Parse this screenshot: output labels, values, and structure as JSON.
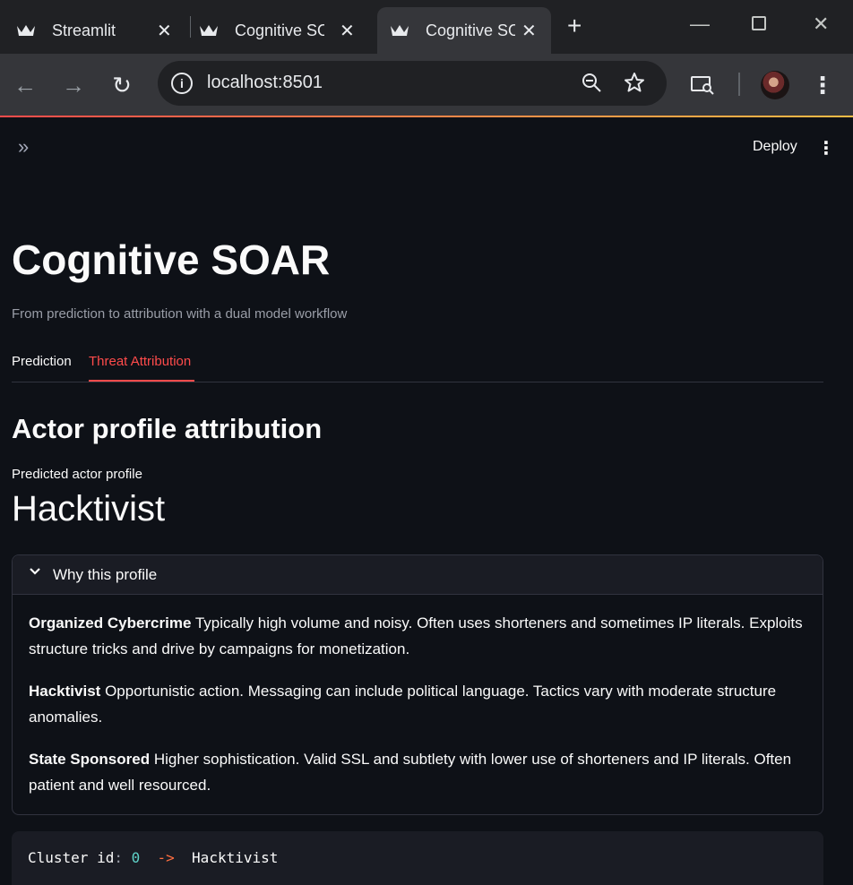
{
  "browser": {
    "tabs": [
      {
        "title": "Streamlit",
        "active": false
      },
      {
        "title": "Cognitive SOAR",
        "active": false
      },
      {
        "title": "Cognitive SOAR",
        "active": true
      }
    ],
    "url": "localhost:8501"
  },
  "app": {
    "deploy_label": "Deploy",
    "title": "Cognitive SOAR",
    "caption": "From prediction to attribution with a dual model workflow",
    "tabs": [
      {
        "label": "Prediction",
        "active": false
      },
      {
        "label": "Threat Attribution",
        "active": true
      }
    ],
    "section_title": "Actor profile attribution",
    "metric": {
      "label": "Predicted actor profile",
      "value": "Hacktivist"
    },
    "expander": {
      "title": "Why this profile",
      "expanded": true,
      "profiles": [
        {
          "name": "Organized Cybercrime",
          "text": "Typically high volume and noisy. Often uses shorteners and sometimes IP literals. Exploits structure tricks and drive by campaigns for monetization."
        },
        {
          "name": "Hacktivist",
          "text": "Opportunistic action. Messaging can include political language. Tactics vary with moderate structure anomalies."
        },
        {
          "name": "State Sponsored",
          "text": "Higher sophistication. Valid SSL and subtlety with lower use of shorteners and IP literals. Often patient and well resourced."
        }
      ]
    },
    "code": {
      "key": "Cluster id",
      "colon": ":",
      "cluster": "0",
      "arrow": "->",
      "profile": "Hacktivist"
    }
  },
  "colors": {
    "accent": "#ff4b4b",
    "background": "#0e1117",
    "code_number": "#5fd3c9",
    "code_arrow": "#ff6e40"
  }
}
